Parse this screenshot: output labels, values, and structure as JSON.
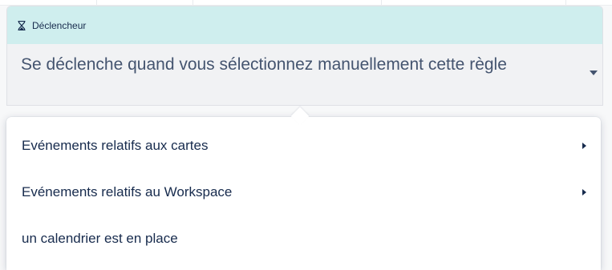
{
  "trigger": {
    "header_label": "Déclencheur",
    "header_icon": "hourglass-icon",
    "selected_value": "Se déclenche quand vous sélectionnez manuellement cette règle",
    "header_bg": "#cfeeee"
  },
  "menu": {
    "items": [
      {
        "label": "Evénements relatifs aux cartes",
        "has_submenu": true
      },
      {
        "label": "Evénements relatifs au Workspace",
        "has_submenu": true
      },
      {
        "label": "un calendrier est en place",
        "has_submenu": false
      }
    ]
  }
}
